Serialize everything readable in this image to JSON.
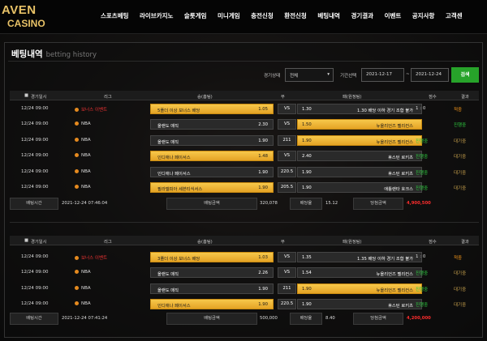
{
  "logo": {
    "line1": "AVEN",
    "line2": "CASINO"
  },
  "nav": [
    "스포츠베팅",
    "라이브카지노",
    "슬롯게임",
    "미니게임",
    "충전신청",
    "환전신청",
    "베팅내역",
    "경기결과",
    "이벤트",
    "공지사항",
    "고객센"
  ],
  "page": {
    "title": "베팅내역",
    "subtitle": "betting history"
  },
  "filter": {
    "status_label": "경기상태",
    "status_value": "전체",
    "period_label": "기간선택",
    "date_from": "2021-12-17",
    "tilde": "~",
    "date_to": "2021-12-24",
    "search": "검색"
  },
  "table_headers": {
    "time": "경기일시",
    "league": "리그",
    "home": "승(홈팀)",
    "draw": "무",
    "away": "패(원정팀)",
    "score": "점수",
    "result": "결과"
  },
  "summary_labels": {
    "bet_time": "배팅시간",
    "bet_amount": "배팅금액",
    "odds": "배당율",
    "win_amount": "당첨금액"
  },
  "bets": [
    {
      "rows": [
        {
          "time": "12/24 09:00",
          "league": "보너스 이벤트",
          "event": true,
          "home": "5폴더 이상 보너스 배당",
          "home_odds": "1.05",
          "home_sel": true,
          "draw": "VS",
          "away_odds": "1.30",
          "away": "1.30 배당 이하 경기 조합 불가",
          "away_sel": false,
          "score": "1 : 0",
          "result": "적중",
          "rc": "o"
        },
        {
          "time": "12/24 09:00",
          "league": "NBA",
          "home": "올랜도 매직",
          "home_odds": "2.30",
          "home_sel": false,
          "draw": "VS",
          "away_odds": "1.50",
          "away": "뉴올리언즈 펠리컨스",
          "away_sel": true,
          "score": "",
          "result": "진행중",
          "rc": "g2"
        },
        {
          "time": "12/24 09:00",
          "league": "NBA",
          "home": "올랜도 매직",
          "home_odds": "1.90",
          "home_sel": false,
          "draw": "211",
          "away_odds": "1.90",
          "away": "뉴올리언즈 펠리컨스",
          "away_sel": true,
          "score": "진행중",
          "result": "대기중",
          "rc": "y"
        },
        {
          "time": "12/24 09:00",
          "league": "NBA",
          "home": "인디애나 페이서스",
          "home_odds": "1.48",
          "home_sel": true,
          "draw": "VS",
          "away_odds": "2.40",
          "away": "휴스턴 로키츠",
          "away_sel": false,
          "score": "진행중",
          "result": "대기중",
          "rc": "y"
        },
        {
          "time": "12/24 09:00",
          "league": "NBA",
          "home": "인디애나 페이서스",
          "home_odds": "1.90",
          "home_sel": false,
          "draw": "220.5",
          "away_odds": "1.90",
          "away": "휴스턴 로키츠",
          "away_sel": false,
          "score": "진행중",
          "result": "대기중",
          "rc": "y"
        },
        {
          "time": "12/24 09:00",
          "league": "NBA",
          "home": "필라델피아 세븐티식서스",
          "home_odds": "1.90",
          "home_sel": true,
          "draw": "205.5",
          "away_odds": "1.90",
          "away": "애틀랜타 호크스",
          "away_sel": false,
          "score": "진행중",
          "result": "대기중",
          "rc": "y"
        }
      ],
      "summary": {
        "bet_time": "2021-12-24 07:46:04",
        "bet_amount": "320,078",
        "odds": "15.12",
        "win_amount": "4,900,500"
      }
    },
    {
      "rows": [
        {
          "time": "12/24 09:00",
          "league": "보너스 이벤트",
          "event": true,
          "home": "3폴더 이상 보너스 배당",
          "home_odds": "1.03",
          "home_sel": true,
          "draw": "VS",
          "away_odds": "1.35",
          "away": "1.35 배당 이하 경기 조합 불가",
          "away_sel": false,
          "score": "1 : 0",
          "result": "적중",
          "rc": "o"
        },
        {
          "time": "12/24 09:00",
          "league": "NBA",
          "home": "올랜도 매직",
          "home_odds": "2.26",
          "home_sel": false,
          "draw": "VS",
          "away_odds": "1.54",
          "away": "뉴올리언즈 펠리컨스",
          "away_sel": false,
          "score": "진행중",
          "result": "대기중",
          "rc": "y"
        },
        {
          "time": "12/24 09:00",
          "league": "NBA",
          "home": "올랜도 매직",
          "home_odds": "1.90",
          "home_sel": false,
          "draw": "211",
          "away_odds": "1.90",
          "away": "뉴올리언즈 펠리컨스",
          "away_sel": true,
          "score": "진행중",
          "result": "대기중",
          "rc": "y"
        },
        {
          "time": "12/24 09:00",
          "league": "NBA",
          "home": "인디애나 페이서스",
          "home_odds": "1.90",
          "home_sel": true,
          "draw": "220.5",
          "away_odds": "1.90",
          "away": "휴스턴 로키츠",
          "away_sel": false,
          "score": "진행중",
          "result": "대기중",
          "rc": "y"
        }
      ],
      "summary": {
        "bet_time": "2021-12-24 07:41:24",
        "bet_amount": "500,000",
        "odds": "8.40",
        "win_amount": "4,200,000"
      }
    }
  ]
}
